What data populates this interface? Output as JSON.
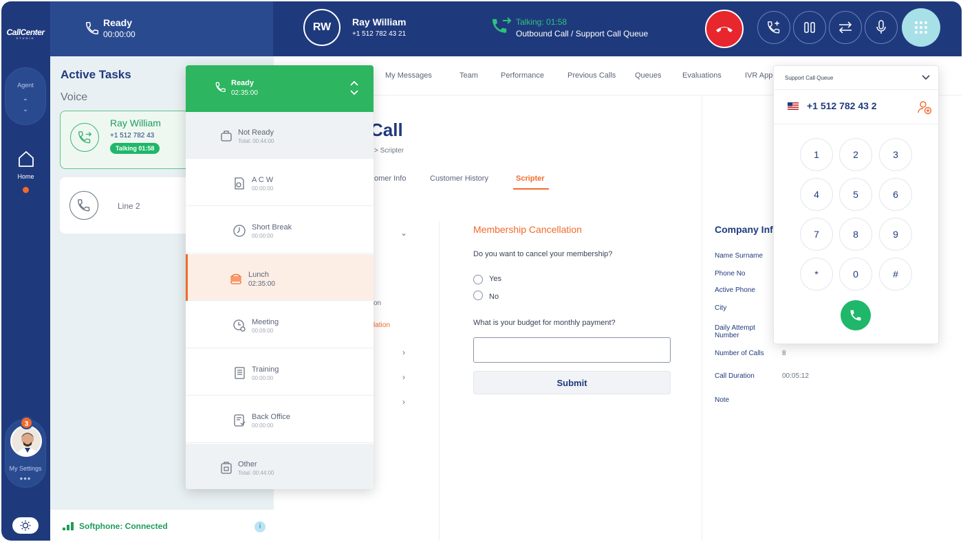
{
  "app": {
    "logo": "CallCenter",
    "logo_sub": "STUDIO"
  },
  "sidebar": {
    "agent_label": "Agent",
    "home_label": "Home",
    "settings_label": "My Settings",
    "notification_count": "3"
  },
  "topbar": {
    "status": "Ready",
    "status_time": "00:00:00",
    "caller_initials": "RW",
    "caller_name": "Ray William",
    "caller_phone": "+1 512 782 43 21",
    "talking": "Talking: 01:58",
    "queue": "Outbound Call / Support Call Queue"
  },
  "tasks": {
    "title": "Active Tasks",
    "section": "Voice",
    "active_card": {
      "name": "Ray William",
      "phone": "+1 512 782 43",
      "badge": "Talking 01:58"
    },
    "line2": {
      "name": "Line 2"
    }
  },
  "softphone": {
    "status": "Softphone: Connected"
  },
  "tabs": [
    "My Messages",
    "Team",
    "Performance",
    "Previous Calls",
    "Queues",
    "Evaluations",
    "IVR Appl"
  ],
  "page": {
    "title": "Call",
    "breadcrumb": "> Scripter",
    "subtabs": [
      "omer Info",
      "Customer History",
      "Scripter"
    ],
    "left_partial": [
      "on",
      "lation"
    ]
  },
  "form": {
    "title": "Membership Cancellation",
    "question1": "Do you want to cancel your membership?",
    "options": [
      "Yes",
      "No"
    ],
    "question2": "What is your budget for monthly payment?",
    "submit": "Submit"
  },
  "company": {
    "title": "Company Inf",
    "fields": [
      {
        "label": "Name Surname",
        "value": ""
      },
      {
        "label": "Phone No",
        "value": ""
      },
      {
        "label": "Active  Phone",
        "value": ""
      },
      {
        "label": "City",
        "value": ""
      },
      {
        "label": "Daily Attempt Number",
        "value": ""
      },
      {
        "label": "Number of Calls",
        "value": "8"
      },
      {
        "label": "Call Duration",
        "value": "00:05:12"
      },
      {
        "label": "Note",
        "value": ""
      }
    ]
  },
  "status_dropdown": {
    "current": {
      "label": "Ready",
      "time": "02:35:00"
    },
    "items": [
      {
        "label": "Not Ready",
        "time": "Total: 00:44:00",
        "icon": "not-ready-icon"
      },
      {
        "label": "A C W",
        "time": "00:00:00",
        "icon": "acw-icon"
      },
      {
        "label": "Short Break",
        "time": "00:00:00",
        "icon": "clock-icon"
      },
      {
        "label": "Lunch",
        "time": "02:35:00",
        "icon": "burger-icon"
      },
      {
        "label": "Meeting",
        "time": "00:09:00",
        "icon": "meeting-icon"
      },
      {
        "label": "Training",
        "time": "00:00:00",
        "icon": "book-icon"
      },
      {
        "label": "Back Office",
        "time": "00:00:00",
        "icon": "back-office-icon"
      },
      {
        "label": "Other",
        "time": "Total: 00:44:00",
        "icon": "other-icon"
      }
    ]
  },
  "dialer": {
    "queue": "Support Call Queue",
    "number": "+1 512 782 43 2",
    "keys": [
      "1",
      "2",
      "3",
      "4",
      "5",
      "6",
      "7",
      "8",
      "9",
      "*",
      "0",
      "#"
    ]
  },
  "colors": {
    "navy": "#1f3a7c",
    "green": "#2db560",
    "orange": "#f26a2a",
    "red": "#e8262d"
  }
}
